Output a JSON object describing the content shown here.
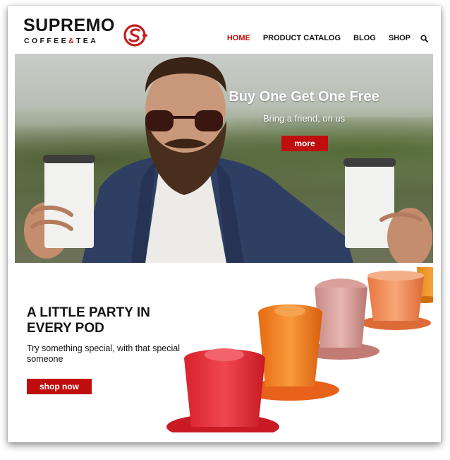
{
  "brand": {
    "name": "SUPREMO",
    "sub_left": "COFFEE",
    "sub_amp": "&",
    "sub_right": "TEA",
    "accent_color": "#c00e0e"
  },
  "nav": {
    "items": [
      {
        "label": "HOME",
        "active": true
      },
      {
        "label": "PRODUCT CATALOG",
        "active": false
      },
      {
        "label": "BLOG",
        "active": false
      },
      {
        "label": "SHOP",
        "active": false
      }
    ],
    "search_icon": "search-icon"
  },
  "hero": {
    "title": "Buy One Get One Free",
    "subtitle": "Bring a friend, on us",
    "button_label": "more"
  },
  "promo": {
    "title": "A LITTLE PARTY IN EVERY POD",
    "subtitle": "Try something special, with that special someone",
    "button_label": "shop now"
  }
}
